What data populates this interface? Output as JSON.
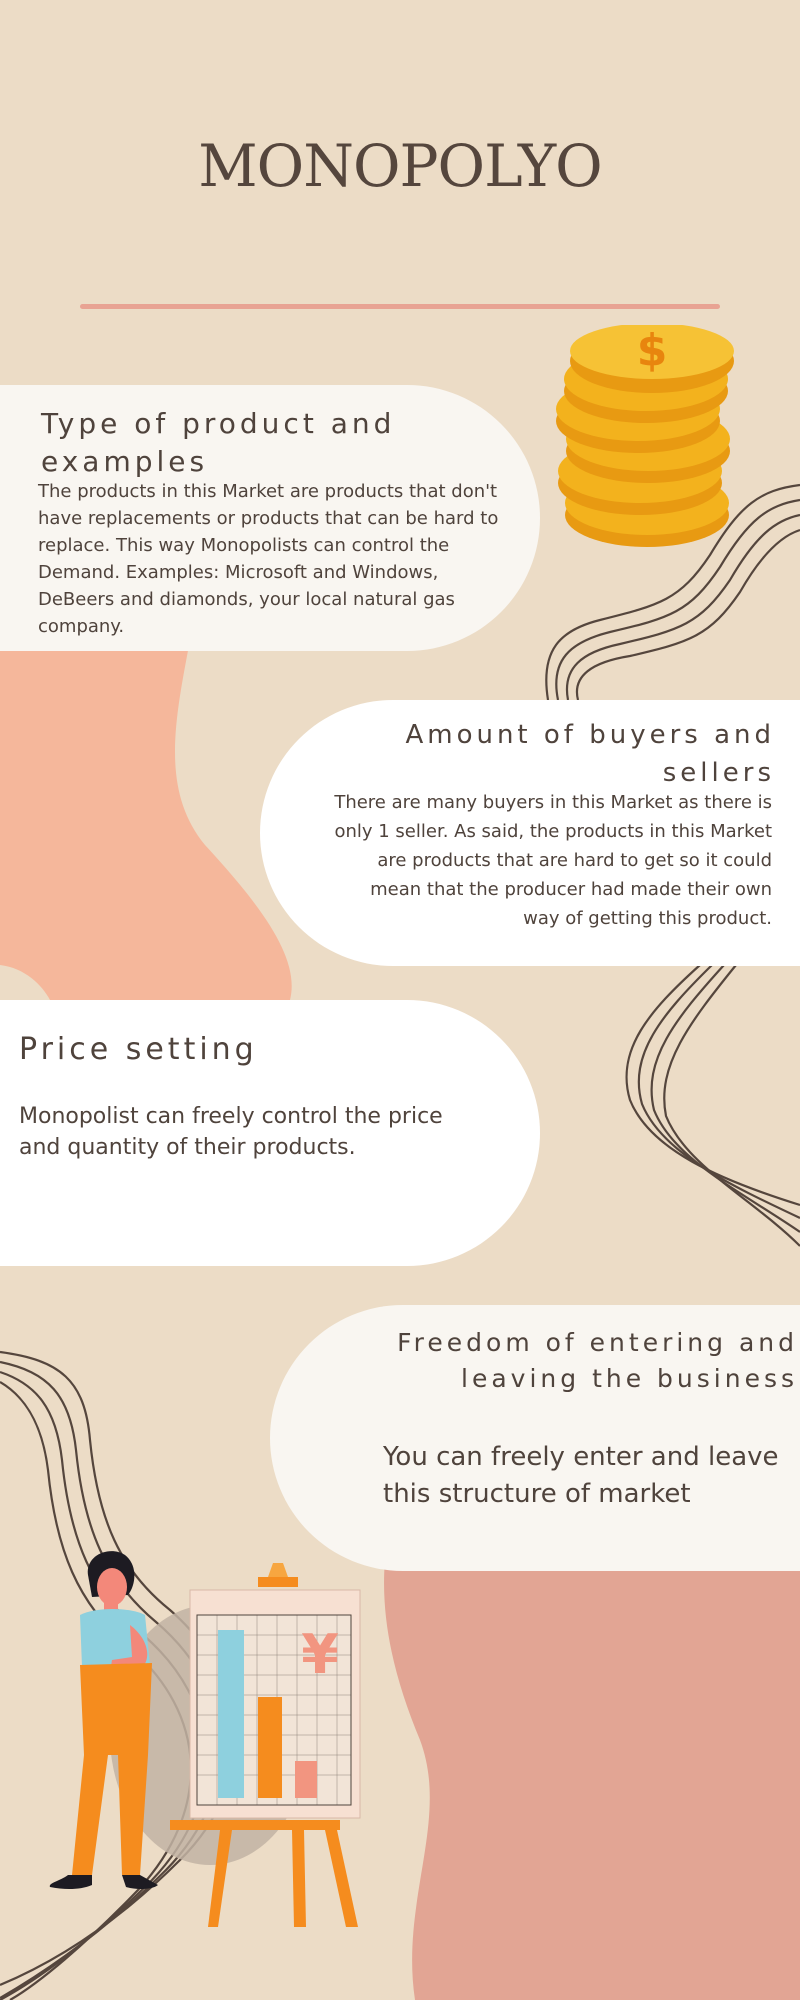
{
  "title": "MONOPOLYO",
  "colors": {
    "background": "#ecdcc6",
    "accent_line": "#e8a393",
    "card_cream": "#f9f6f1",
    "card_white": "#ffffff",
    "blob_peach": "#f5b79b",
    "blob_rose": "#e2a594",
    "text": "#4f433c",
    "coin_gold": "#f3b21d"
  },
  "sections": [
    {
      "heading": "Type of product and examples",
      "body": "The products in this Market are products that don't have replacements or products that can be hard to replace. This way Monopolists can control the Demand. Examples: Microsoft and Windows, DeBeers and diamonds, your local natural gas company."
    },
    {
      "heading": "Amount of buyers and sellers",
      "body": "There are many buyers in this Market as there is only 1 seller. As said, the products in this Market are products that are hard to get so it could mean that the producer had made their own way of getting this product."
    },
    {
      "heading": "Price setting",
      "body": "Monopolist can freely control the price and quantity of their products."
    },
    {
      "heading": "Freedom of entering and leaving the business",
      "body": "You can freely enter and leave this structure of market"
    }
  ],
  "illustrations": {
    "coins_symbol": "$",
    "coins_icon": "coin-stack-icon",
    "chart_symbol": "¥",
    "chart_icon": "bar-chart-easel-icon",
    "person_icon": "thinking-woman-icon"
  }
}
